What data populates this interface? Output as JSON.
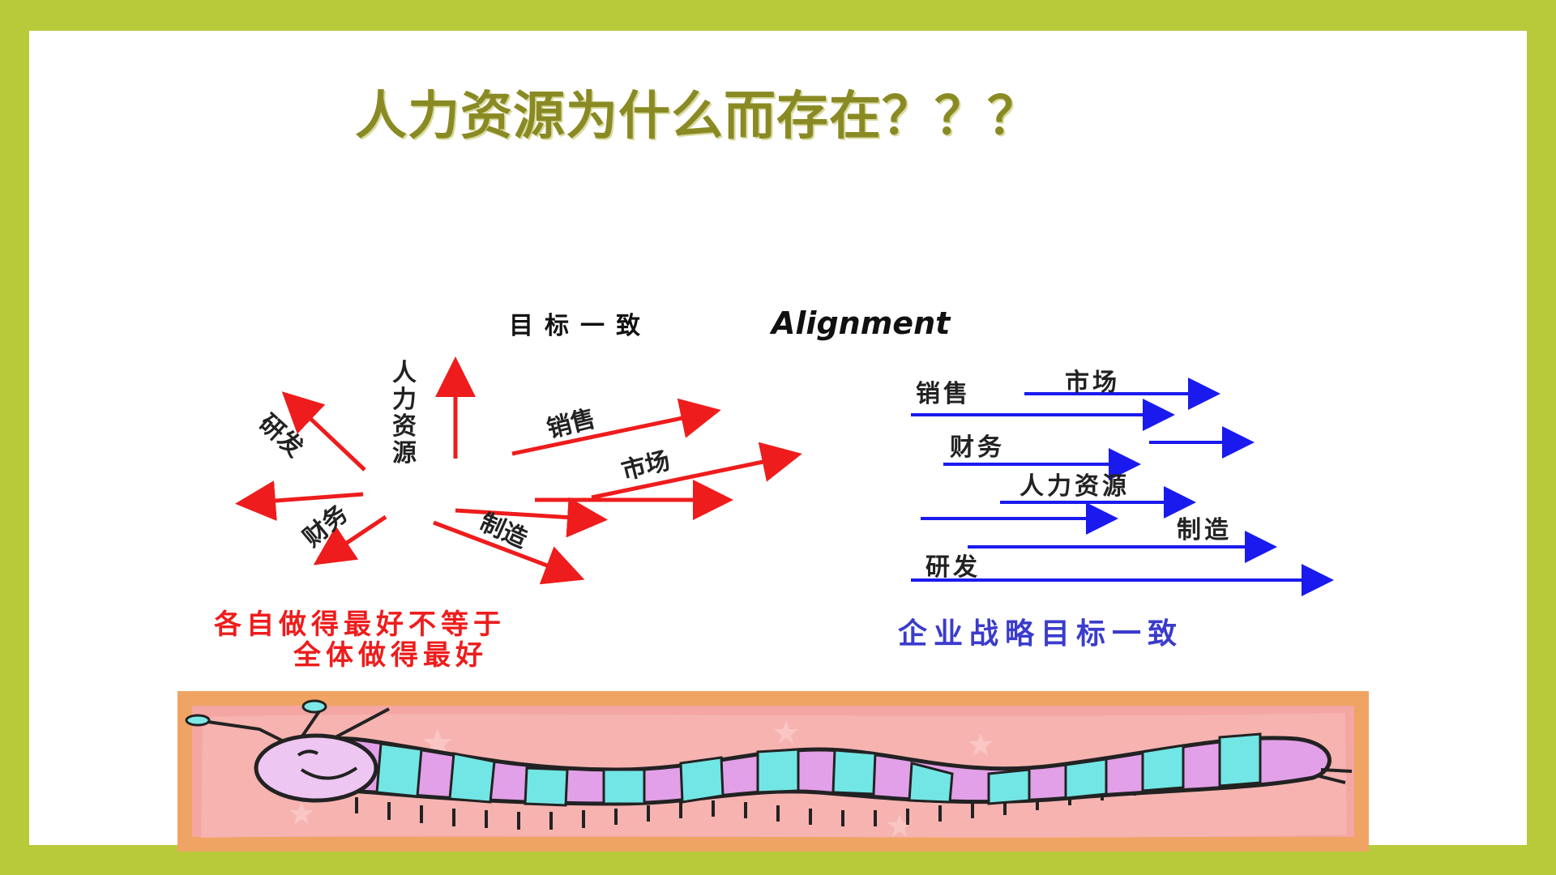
{
  "slide": {
    "title": "人力资源为什么而存在？？？",
    "colors": {
      "border": "#b8c93a",
      "title": "#8a8a24",
      "red": "#ee1c1c",
      "blue": "#1a1aee",
      "blue_caption": "#3b3bcc",
      "caterpillar_bg": "#f5a5a5",
      "caterpillar_border": "#f5a060"
    }
  },
  "diagram": {
    "heading_cn": "目标一致",
    "heading_en": "Alignment",
    "left_labels": {
      "hr": "人力资源",
      "rd": "研发",
      "sales": "销售",
      "market": "市场",
      "finance": "财务",
      "manufacturing": "制造"
    },
    "left_caption_line1": "各自做得最好不等于",
    "left_caption_line2": "全体做得最好",
    "right_labels": {
      "sales": "销售",
      "market": "市场",
      "finance": "财务",
      "hr": "人力资源",
      "manufacturing": "制造",
      "rd": "研发"
    },
    "right_caption": "企业战略目标一致"
  },
  "illustration": {
    "icon": "caterpillar-illustration"
  }
}
